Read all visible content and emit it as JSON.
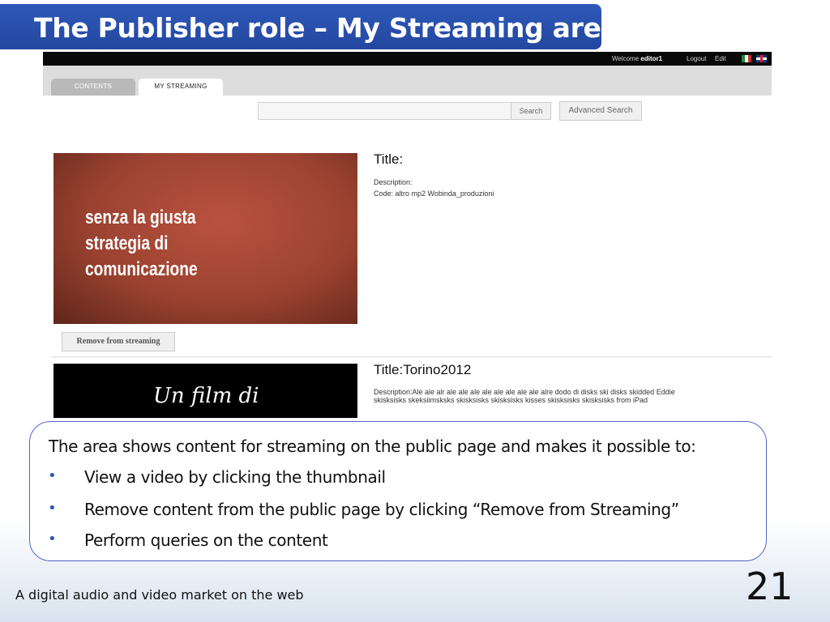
{
  "slide": {
    "title": "The Publisher role – My Streaming area",
    "footer": "A digital audio and video market on the web",
    "page_number": "21"
  },
  "app": {
    "topbar": {
      "welcome_prefix": "Welcome ",
      "username": "editor1",
      "logout": "Logout",
      "edit": "Edit"
    },
    "tabs": [
      {
        "label": "CONTENTS",
        "active": false
      },
      {
        "label": "MY STREAMING",
        "active": true
      }
    ],
    "search": {
      "value": "",
      "button": "Search",
      "advanced_button": "Advanced Search"
    },
    "items": [
      {
        "thumbnail_lines": [
          "senza la giusta",
          "strategia di",
          "comunicazione"
        ],
        "title": "Title:",
        "description": "Description:",
        "code": "Code: altro mp2 Wobinda_produzioni",
        "remove_label": "Remove from streaming"
      },
      {
        "thumbnail_text": "Un film di",
        "title": "Title:Torino2012",
        "description": "Description:Ale ale alr ale ale ale ale ale ale ale ale alre dodo di disks ski disks skidded Eddie skisksisks skeksiimsksks skisksisks skisksisks kisses skisksisks skisksisks from iPad"
      }
    ]
  },
  "callout": {
    "intro": "The area shows content for streaming on the public page and makes it possible to:",
    "bullets": [
      "View a video by clicking the thumbnail",
      "Remove content from the public page by clicking “Remove from Streaming”",
      "Perform queries on the content"
    ]
  },
  "colors": {
    "title_bar": "#2a52b0",
    "callout_border": "#4f67c9",
    "flag_green": "#1f8a3c",
    "flag_red": "#c8322a"
  },
  "icons": [
    "italian-flag-icon",
    "uk-flag-icon"
  ]
}
